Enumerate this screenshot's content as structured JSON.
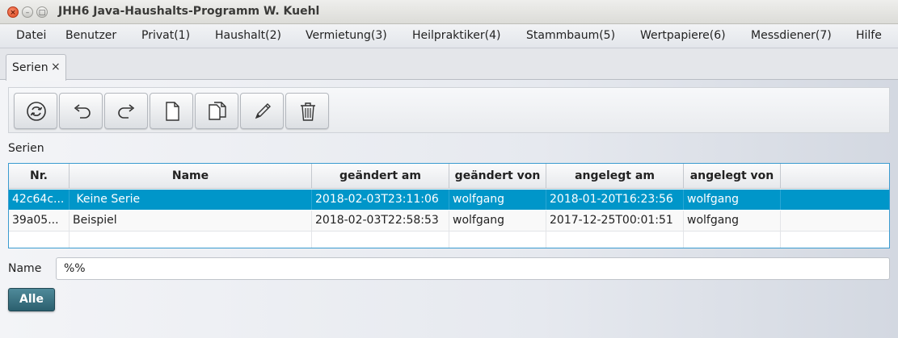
{
  "window": {
    "title": "JHH6 Java-Haushalts-Programm W. Kuehl",
    "close_glyph": "×",
    "minimize_glyph": "–",
    "maximize_glyph": "□"
  },
  "menu": [
    "Datei",
    "Benutzer",
    "Privat(1)",
    "Haushalt(2)",
    "Vermietung(3)",
    "Heilpraktiker(4)",
    "Stammbaum(5)",
    "Wertpapiere(6)",
    "Messdiener(7)",
    "Hilfe"
  ],
  "tab": {
    "label": "Serien",
    "close_glyph": "×"
  },
  "toolbar": {
    "buttons": [
      "refresh-icon",
      "undo-icon",
      "redo-icon",
      "new-document-icon",
      "copy-document-icon",
      "edit-pencil-icon",
      "delete-trash-icon"
    ]
  },
  "section": {
    "label": "Serien"
  },
  "table": {
    "columns": [
      "Nr.",
      "Name",
      "geändert am",
      "geändert von",
      "angelegt am",
      "angelegt von"
    ],
    "rows": [
      [
        "42c64c...",
        " Keine Serie",
        "2018-02-03T23:11:06",
        "wolfgang",
        "2018-01-20T16:23:56",
        "wolfgang"
      ],
      [
        "39a05...",
        "Beispiel",
        "2018-02-03T22:58:53",
        "wolfgang",
        "2017-12-25T00:01:51",
        "wolfgang"
      ]
    ],
    "selected_row": 0
  },
  "filter": {
    "name_label": "Name",
    "name_value": "%%",
    "all_button": "Alle"
  },
  "colors": {
    "selection": "#0096c9",
    "accent_button": "#2b5f6e"
  }
}
